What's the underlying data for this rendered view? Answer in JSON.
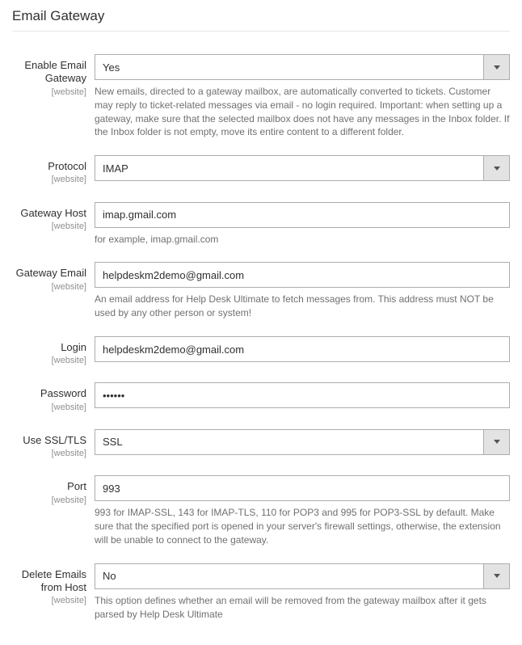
{
  "section": {
    "title": "Email Gateway"
  },
  "scope_label": "[website]",
  "fields": {
    "enable": {
      "label": "Enable Email Gateway",
      "value": "Yes",
      "help": "New emails, directed to a gateway mailbox, are automatically converted to tickets. Customer may reply to ticket-related messages via email - no login required. Important: when setting up a gateway, make sure that the selected mailbox does not have any messages in the Inbox folder. If the Inbox folder is not empty, move its entire content to a different folder."
    },
    "protocol": {
      "label": "Protocol",
      "value": "IMAP"
    },
    "host": {
      "label": "Gateway Host",
      "value": "imap.gmail.com",
      "help": "for example, imap.gmail.com"
    },
    "email": {
      "label": "Gateway Email",
      "value": "helpdeskm2demo@gmail.com",
      "help": "An email address for Help Desk Ultimate to fetch messages from. This address must NOT be used by any other person or system!"
    },
    "login": {
      "label": "Login",
      "value": "helpdeskm2demo@gmail.com"
    },
    "password": {
      "label": "Password",
      "value": "••••••"
    },
    "ssl": {
      "label": "Use SSL/TLS",
      "value": "SSL"
    },
    "port": {
      "label": "Port",
      "value": "993",
      "help": "993 for IMAP-SSL, 143 for IMAP-TLS, 110 for POP3 and 995 for POP3-SSL by default. Make sure that the specified port is opened in your server's firewall settings, otherwise, the extension will be unable to connect to the gateway."
    },
    "delete": {
      "label": "Delete Emails from Host",
      "value": "No",
      "help": "This option defines whether an email will be removed from the gateway mailbox after it gets parsed by Help Desk Ultimate"
    }
  }
}
